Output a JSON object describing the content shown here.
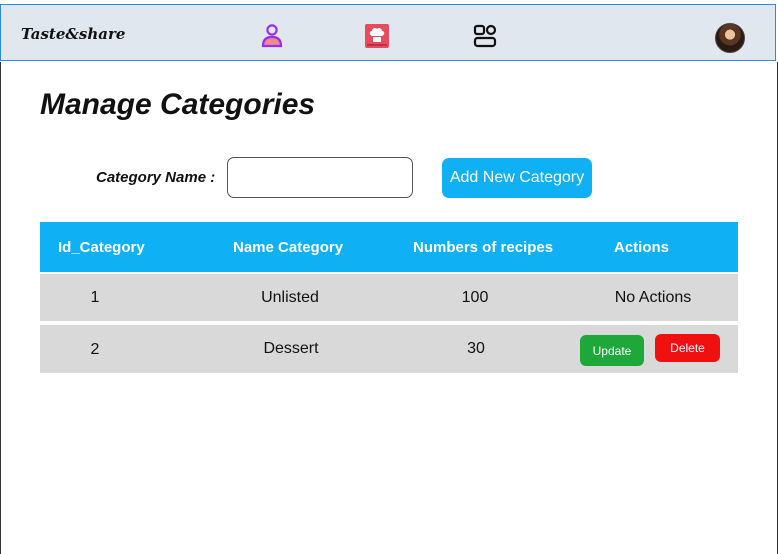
{
  "brand": "Taste&share",
  "nav": {
    "icons": [
      "user-icon",
      "chef-hat-icon",
      "category-settings-icon"
    ],
    "colors": {
      "accent": "#10b0f4",
      "nav_bg": "#e1e7ef",
      "user": "#9b2cf5",
      "recipe": "#e64b5e"
    }
  },
  "page": {
    "title": "Manage Categories"
  },
  "form": {
    "label": "Category Name :",
    "value": "",
    "placeholder": "",
    "add_button": "Add New Category"
  },
  "table": {
    "headers": [
      "Id_Category",
      "Name Category",
      "Numbers of recipes",
      "Actions"
    ],
    "rows": [
      {
        "id": "1",
        "name": "Unlisted",
        "recipes": "100",
        "action_text": "No Actions"
      },
      {
        "id": "2",
        "name": "Dessert",
        "recipes": "30",
        "update_label": "Update",
        "delete_label": "Delete"
      }
    ],
    "colors": {
      "header_bg": "#10b0f4",
      "row_bg": "#d9d9d9",
      "update": "#1fa83a",
      "delete": "#f01010"
    }
  }
}
